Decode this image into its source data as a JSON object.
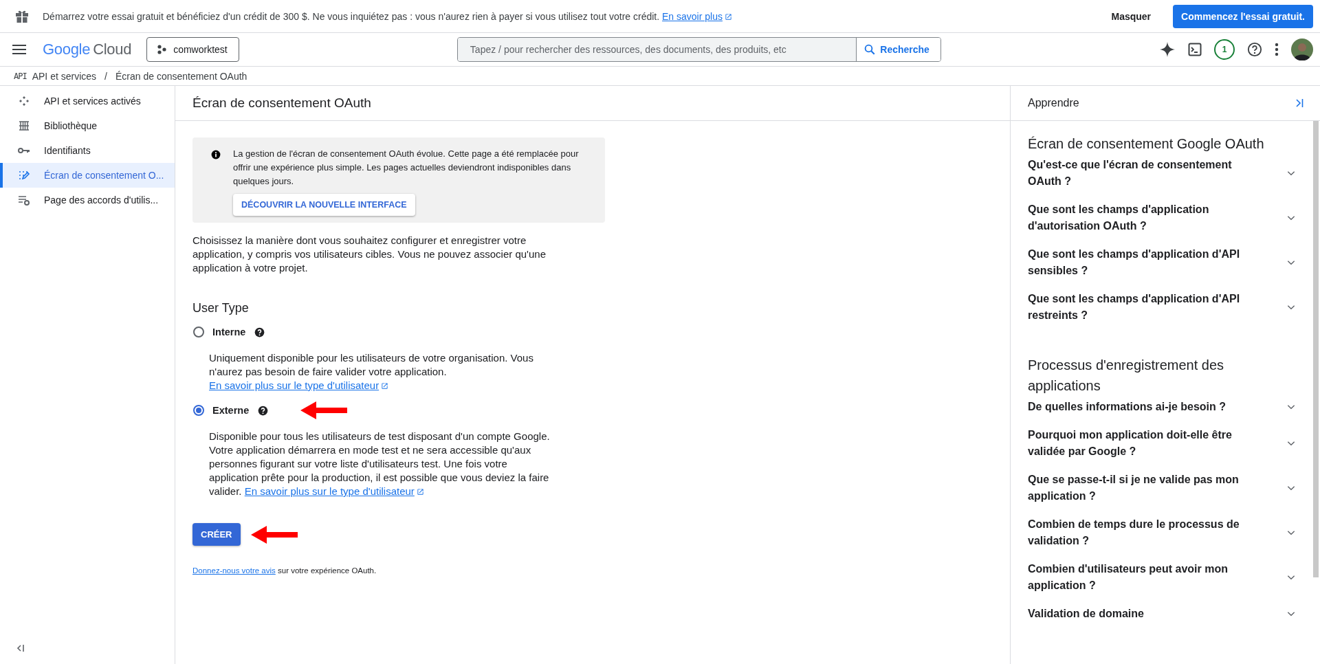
{
  "banner": {
    "text": "Démarrez votre essai gratuit et bénéficiez d'un crédit de 300 $. Ne vous inquiétez pas : vous n'aurez rien à payer si vous utilisez tout votre crédit.",
    "link": "En savoir plus",
    "dismiss": "Masquer",
    "cta": "Commencez l'essai gratuit."
  },
  "header": {
    "logo": "Google",
    "product": "Cloud",
    "project": "comworktest",
    "search": {
      "placeholder": "Tapez / pour rechercher des ressources, des documents, des produits, etc",
      "button": "Recherche"
    },
    "notifications": "1"
  },
  "breadcrumb": {
    "badge": "API",
    "separator": "/",
    "items": [
      "API et services",
      "Écran de consentement OAuth"
    ]
  },
  "sidebar": {
    "items": [
      {
        "label": "API et services activés",
        "selected": false
      },
      {
        "label": "Bibliothèque",
        "selected": false
      },
      {
        "label": "Identifiants",
        "selected": false
      },
      {
        "label": "Écran de consentement O...",
        "selected": true
      },
      {
        "label": "Page des accords d'utilis...",
        "selected": false
      }
    ]
  },
  "main": {
    "title": "Écran de consentement OAuth",
    "notice": {
      "text": "La gestion de l'écran de consentement OAuth évolue. Cette page a été remplacée pour offrir une expérience plus simple. Les pages actuelles deviendront indisponibles dans quelques jours.",
      "button": "DÉCOUVRIR LA NOUVELLE INTERFACE"
    },
    "intro": "Choisissez la manière dont vous souhaitez configurer et enregistrer votre application, y compris vos utilisateurs cibles. Vous ne pouvez associer qu'une application à votre projet.",
    "section_title": "User Type",
    "options": [
      {
        "label": "Interne",
        "selected": false,
        "description": "Uniquement disponible pour les utilisateurs de votre organisation. Vous n'aurez pas besoin de faire valider votre application.",
        "link": "En savoir plus sur le type d'utilisateur"
      },
      {
        "label": "Externe",
        "selected": true,
        "description": "Disponible pour tous les utilisateurs de test disposant d'un compte Google. Votre application démarrera en mode test et ne sera accessible qu'aux personnes figurant sur votre liste d'utilisateurs test. Une fois votre application prête pour la production, il est possible que vous deviez la faire valider.",
        "link": "En savoir plus sur le type d'utilisateur"
      }
    ],
    "create_button": "CRÉER",
    "feedback": {
      "link": "Donnez-nous votre avis",
      "text": "sur votre expérience OAuth."
    }
  },
  "learn": {
    "title": "Apprendre",
    "sections": [
      {
        "title": "Écran de consentement Google OAuth",
        "items": [
          {
            "label": "Qu'est-ce que l'écran de consentement OAuth ?",
            "expanded": false
          },
          {
            "label": "Que sont les champs d'application d'autorisation OAuth ?",
            "expanded": false
          },
          {
            "label": "Que sont les champs d'application d'API sensibles ?",
            "expanded": false
          },
          {
            "label": "Que sont les champs d'application d'API restreints ?",
            "expanded": false
          }
        ]
      },
      {
        "title": "Processus d'enregistrement des applications",
        "items": [
          {
            "label": "De quelles informations ai-je besoin ?",
            "expanded": false
          },
          {
            "label": "Pourquoi mon application doit-elle être validée par Google ?",
            "expanded": false
          },
          {
            "label": "Que se passe-t-il si je ne valide pas mon application ?",
            "expanded": false
          },
          {
            "label": "Combien de temps dure le processus de validation ?",
            "expanded": false
          },
          {
            "label": "Combien d'utilisateurs peut avoir mon application ?",
            "expanded": false
          },
          {
            "label": "Validation de domaine",
            "expanded": false
          }
        ]
      }
    ]
  }
}
